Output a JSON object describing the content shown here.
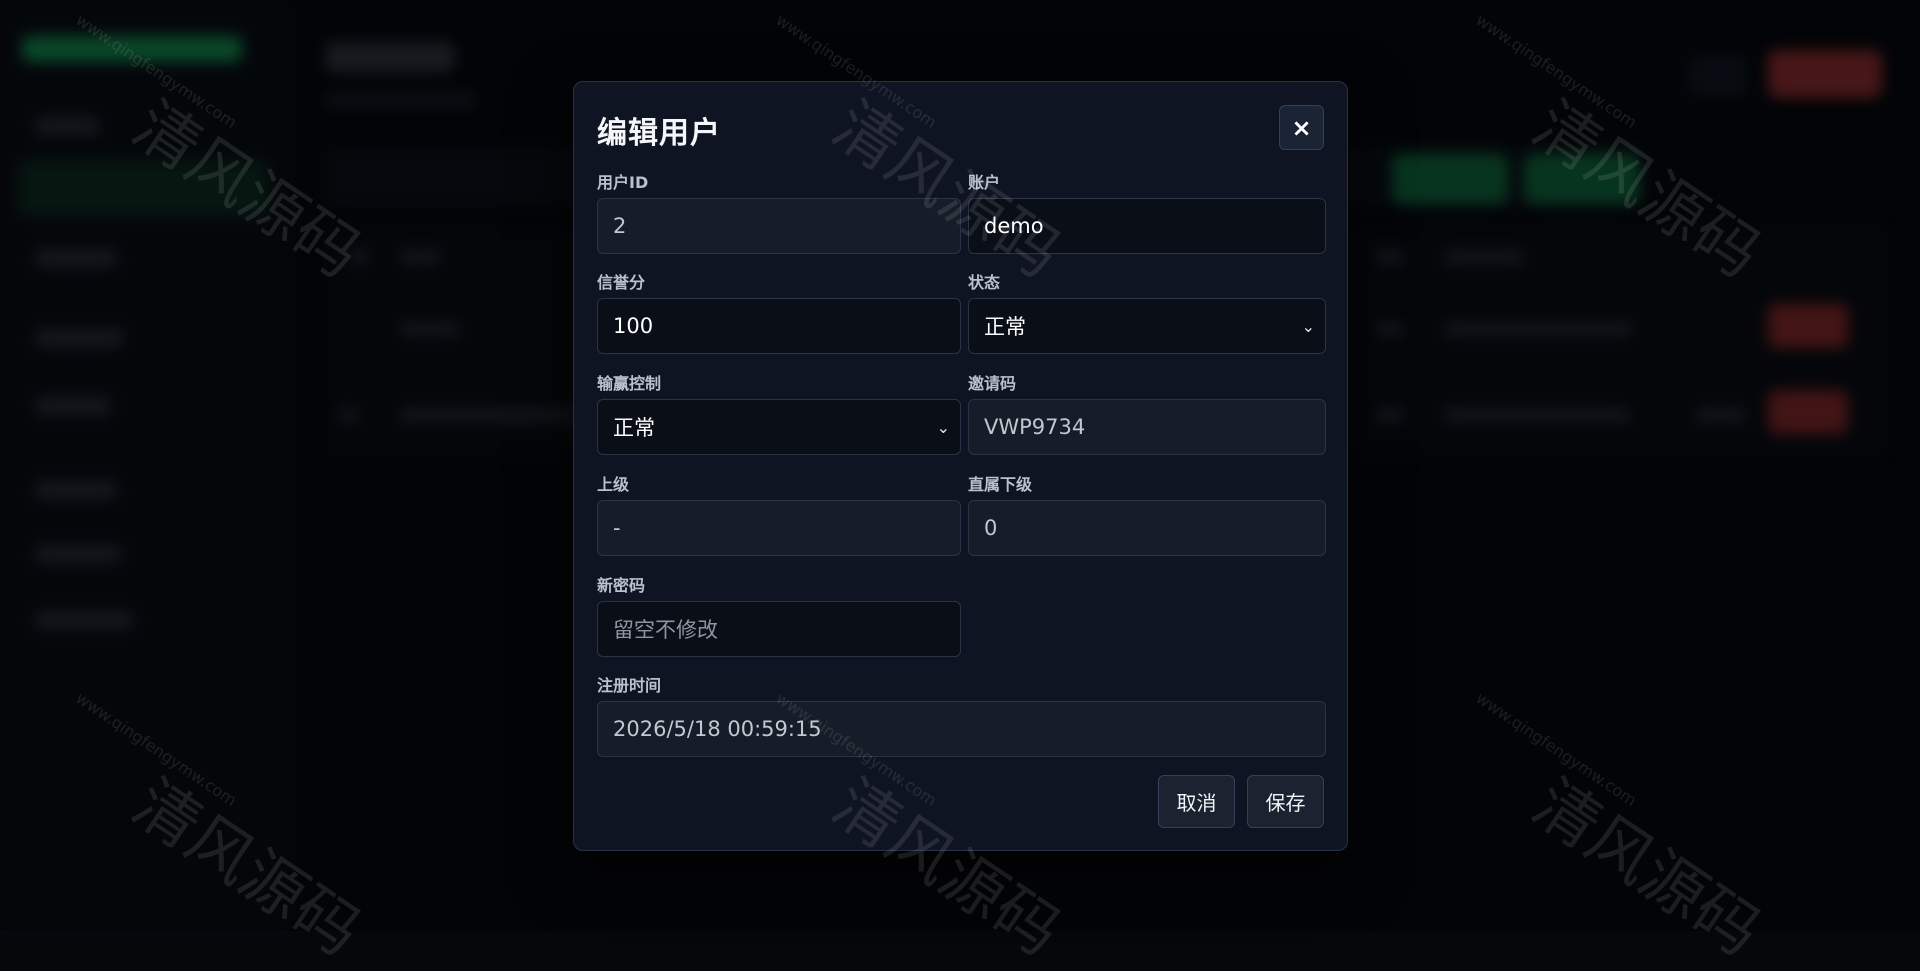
{
  "modal": {
    "title": "编辑用户",
    "close_label": "×",
    "fields": {
      "user_id": {
        "label": "用户ID",
        "value": "2"
      },
      "account": {
        "label": "账户",
        "value": "demo"
      },
      "credit": {
        "label": "信誉分",
        "value": "100"
      },
      "status": {
        "label": "状态",
        "value": "正常"
      },
      "win_control": {
        "label": "输赢控制",
        "value": "正常"
      },
      "invite_code": {
        "label": "邀请码",
        "value": "VWP9734"
      },
      "superior": {
        "label": "上级",
        "value": "-"
      },
      "direct_subordinates": {
        "label": "直属下级",
        "value": "0"
      },
      "new_password": {
        "label": "新密码",
        "placeholder": "留空不修改"
      },
      "register_time": {
        "label": "注册时间",
        "value": "2026/5/18 00:59:15"
      }
    },
    "buttons": {
      "cancel": "取消",
      "save": "保存"
    }
  },
  "watermark": {
    "url": "www.qingfengymw.com",
    "cn": "清风源码"
  },
  "colors": {
    "modal_bg": "#0e1421",
    "accent_green": "#18c06a",
    "danger_red": "#c43b3b"
  }
}
